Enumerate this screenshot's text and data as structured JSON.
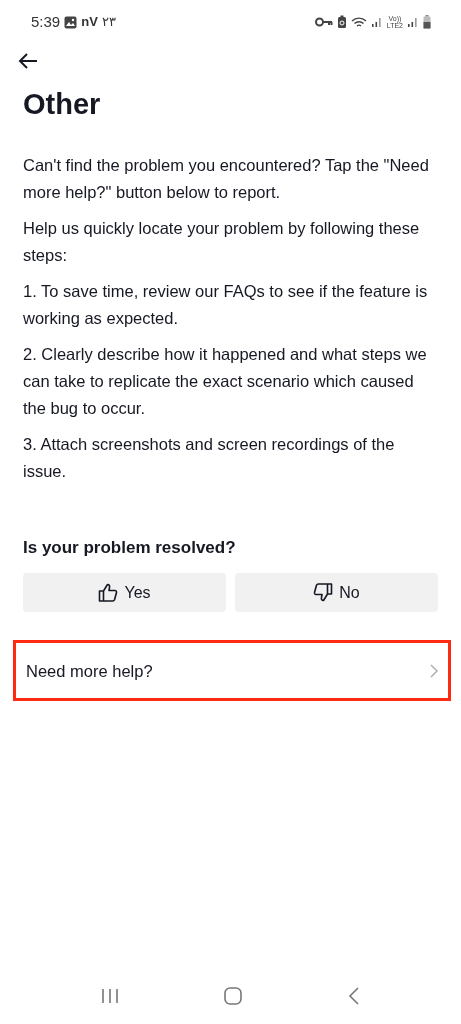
{
  "status_bar": {
    "time": "5:39",
    "app_label": "nV",
    "notification_count": "٢٣",
    "volte_top": "Vo))",
    "volte_bottom": "LTE2"
  },
  "title": "Other",
  "paragraphs": [
    "Can't find the problem you encountered? Tap the \"Need more help?\" button below to report.",
    "Help us quickly locate your problem by following these steps:",
    "1. To save time, review our FAQs to see if the feature is working as expected.",
    "2. Clearly describe how it happened and what steps we can take to replicate the exact scenario which caused the bug to occur.",
    "3. Attach screenshots and screen recordings of the issue."
  ],
  "feedback": {
    "question": "Is your problem resolved?",
    "buttons": [
      {
        "kind": "up",
        "label": "Yes"
      },
      {
        "kind": "down",
        "label": "No"
      }
    ]
  },
  "help_row": {
    "label": "Need more help?",
    "highlighted": true
  }
}
